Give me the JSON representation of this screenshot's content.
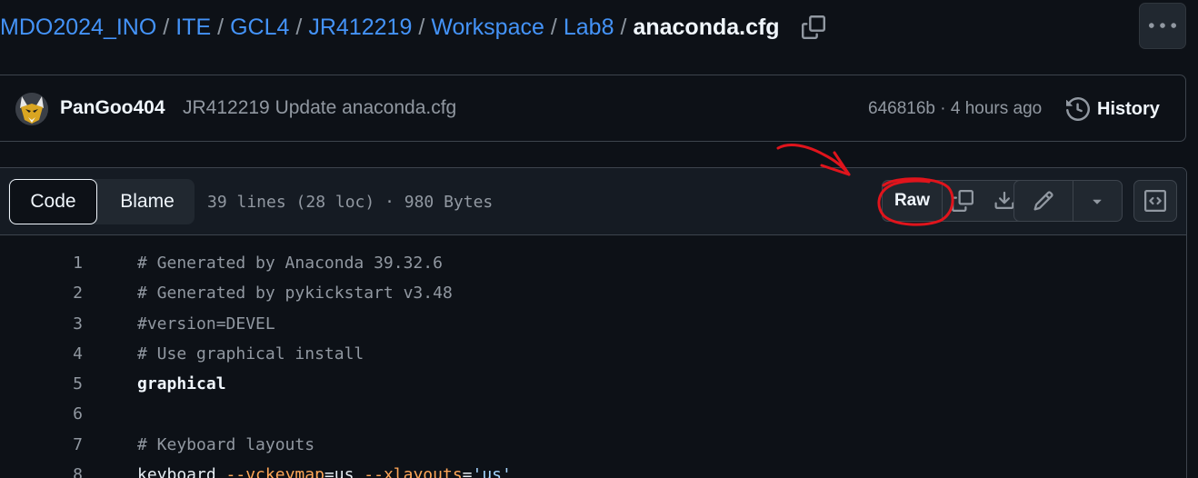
{
  "breadcrumb": {
    "items": [
      "MDO2024_INO",
      "ITE",
      "GCL4",
      "JR412219",
      "Workspace",
      "Lab8"
    ],
    "separator": "/",
    "current": "anaconda.cfg"
  },
  "commit": {
    "author": "PanGoo404",
    "message": "JR412219 Update anaconda.cfg",
    "meta": "646816b · 4 hours ago",
    "history_label": "History"
  },
  "file_header": {
    "tab_code": "Code",
    "tab_blame": "Blame",
    "info": "39 lines (28 loc) · 980 Bytes",
    "raw_label": "Raw"
  },
  "code_lines": [
    {
      "n": "1",
      "text": "# Generated by Anaconda 39.32.6",
      "kind": "comment"
    },
    {
      "n": "2",
      "text": "# Generated by pykickstart v3.48",
      "kind": "comment"
    },
    {
      "n": "3",
      "text": "#version=DEVEL",
      "kind": "comment"
    },
    {
      "n": "4",
      "text": "# Use graphical install",
      "kind": "comment"
    },
    {
      "n": "5",
      "text": "graphical",
      "kind": "keyword"
    },
    {
      "n": "6",
      "text": "",
      "kind": "plain"
    },
    {
      "n": "7",
      "text": "# Keyboard layouts",
      "kind": "comment"
    },
    {
      "n": "8",
      "text": "keyboard --vckeymap=us --xlayouts='us'",
      "kind": "mixed"
    }
  ],
  "icons": {
    "copy_path": "copy-icon",
    "more": "kebab-horizontal-icon",
    "history": "history-icon",
    "copy_raw": "copy-icon",
    "download": "download-icon",
    "edit": "pencil-icon",
    "caret": "triangle-down-icon",
    "symbols": "code-square-icon"
  },
  "colors": {
    "background": "#0d1117",
    "link": "#4493f8",
    "annotation": "#e0141c"
  }
}
